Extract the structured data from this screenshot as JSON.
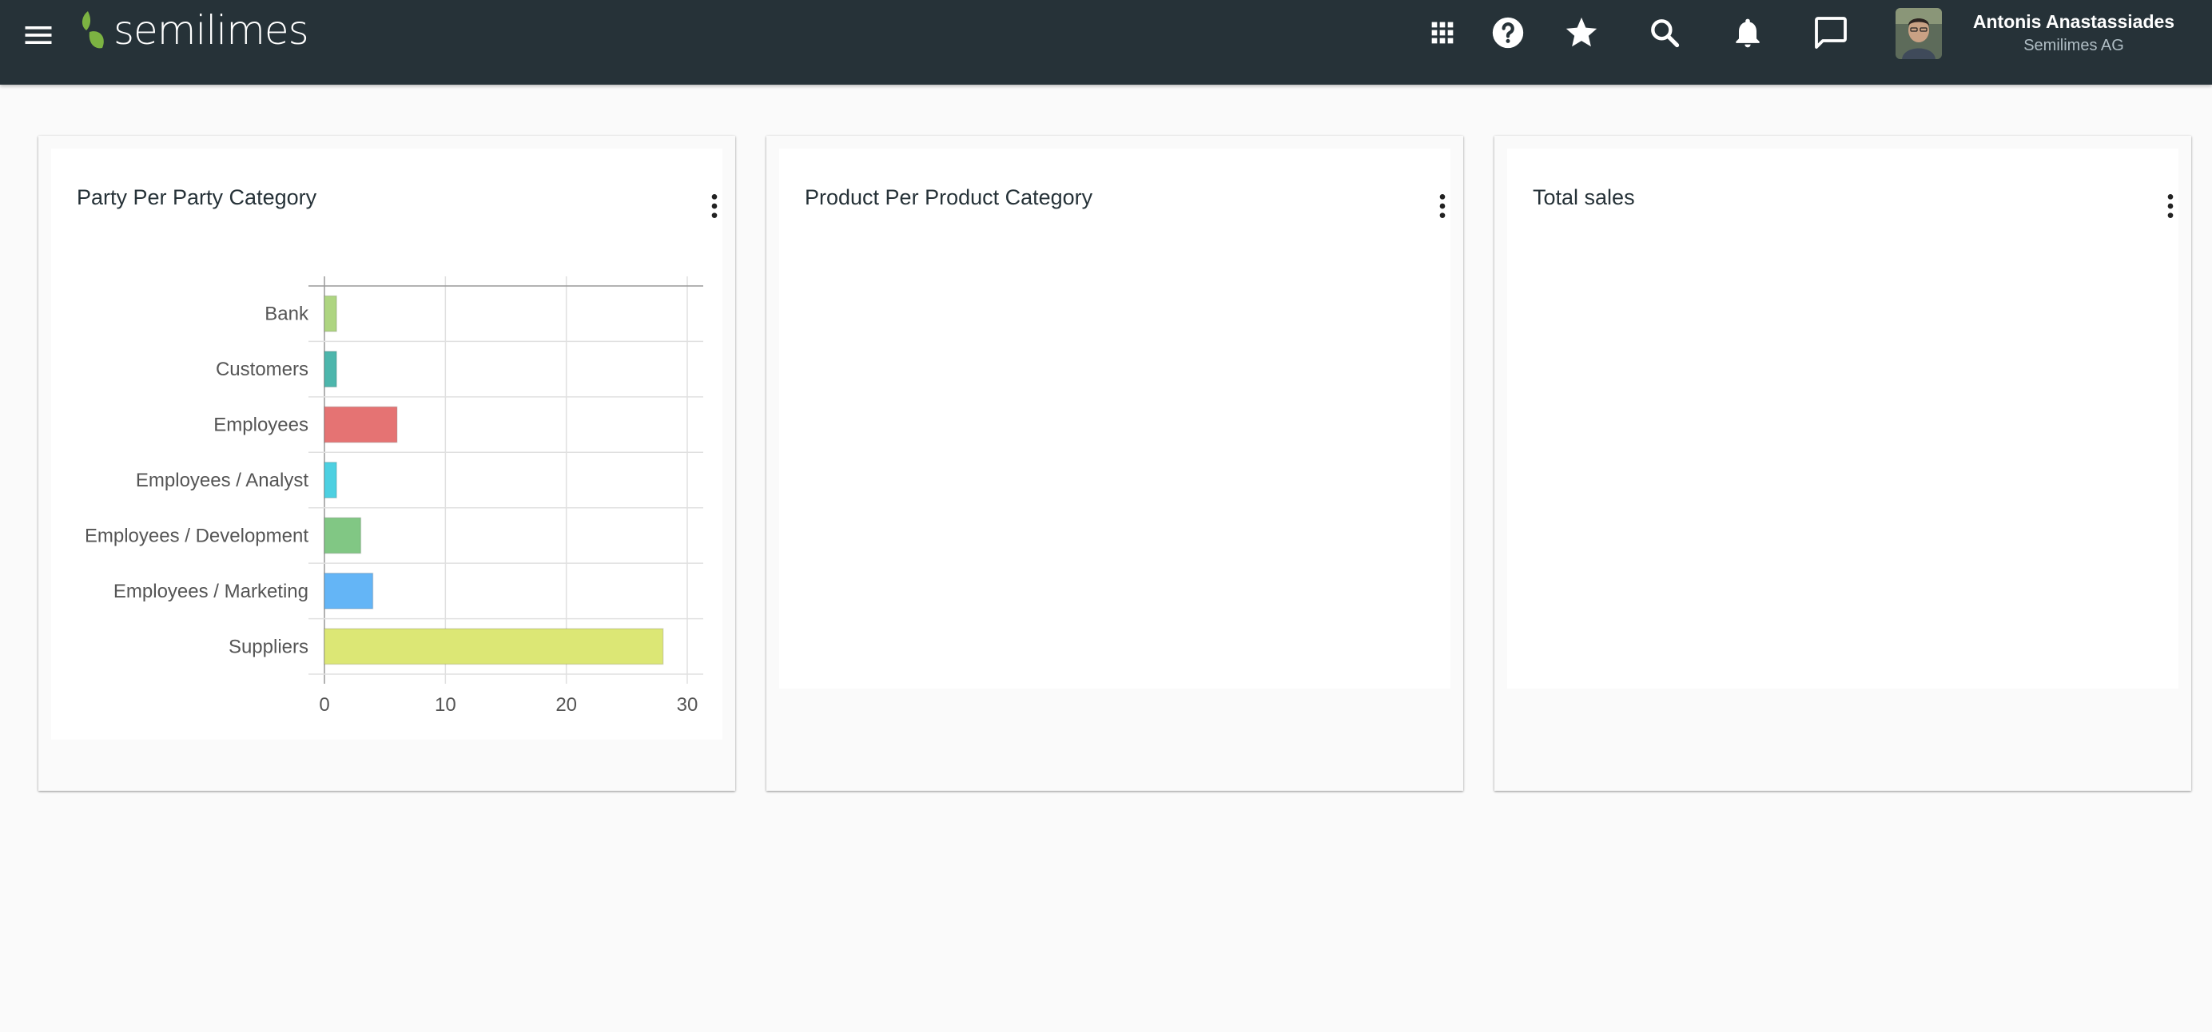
{
  "app": {
    "logo_text": "semilimes"
  },
  "topbar": {
    "icons": [
      "menu-icon",
      "apps-grid-icon",
      "help-icon",
      "star-icon",
      "search-icon",
      "bell-icon",
      "chat-icon"
    ],
    "user": {
      "name": "Antonis Anastassiades",
      "company": "Semilimes AG"
    }
  },
  "cards": [
    {
      "title": "Party Per Party Category"
    },
    {
      "title": "Product Per Product Category"
    },
    {
      "title": "Total sales"
    }
  ],
  "chart_data": {
    "type": "bar",
    "orientation": "horizontal",
    "categories": [
      "Bank",
      "Customers",
      "Employees",
      "Employees / Analyst",
      "Employees / Development",
      "Employees / Marketing",
      "Suppliers"
    ],
    "values": [
      1,
      1,
      6,
      1,
      3,
      4,
      28
    ],
    "colors": [
      "#aed581",
      "#4db6ac",
      "#e57373",
      "#4dd0e1",
      "#81c784",
      "#64b5f6",
      "#dce775"
    ],
    "xlim": [
      0,
      30
    ],
    "xticks": [
      0,
      10,
      20,
      30
    ],
    "grid": true
  }
}
